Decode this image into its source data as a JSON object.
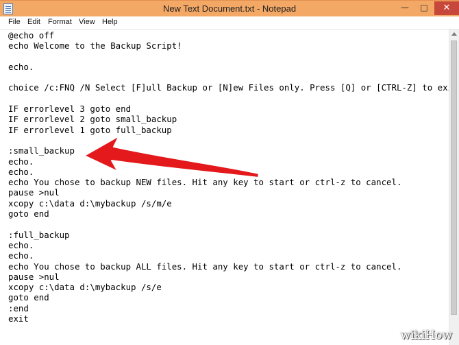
{
  "window": {
    "title": "New Text Document.txt - Notepad",
    "controls": {
      "minimize": "—",
      "maximize": "□",
      "close": "✕"
    }
  },
  "menu": {
    "file": "File",
    "edit": "Edit",
    "format": "Format",
    "view": "View",
    "help": "Help"
  },
  "document": {
    "text": "@echo off\necho Welcome to the Backup Script!\n\necho.\n\nchoice /c:FNQ /N Select [F]ull Backup or [N]ew Files only. Press [Q] or [CTRL-Z] to exit.\n\nIF errorlevel 3 goto end\nIF errorlevel 2 goto small_backup\nIF errorlevel 1 goto full_backup\n\n:small_backup\necho.\necho.\necho You chose to backup NEW files. Hit any key to start or ctrl-z to cancel.\npause >nul\nxcopy c:\\data d:\\mybackup /s/m/e\ngoto end\n\n:full_backup\necho.\necho.\necho You chose to backup ALL files. Hit any key to start or ctrl-z to cancel.\npause >nul\nxcopy c:\\data d:\\mybackup /s/e\ngoto end\n:end\nexit"
  },
  "annotation": {
    "arrow_color": "#e3191c"
  },
  "watermark": "wikiHow",
  "colors": {
    "titlebar": "#f3a866",
    "close_button": "#c7483a"
  },
  "icons": {
    "app": "notepad-icon"
  }
}
